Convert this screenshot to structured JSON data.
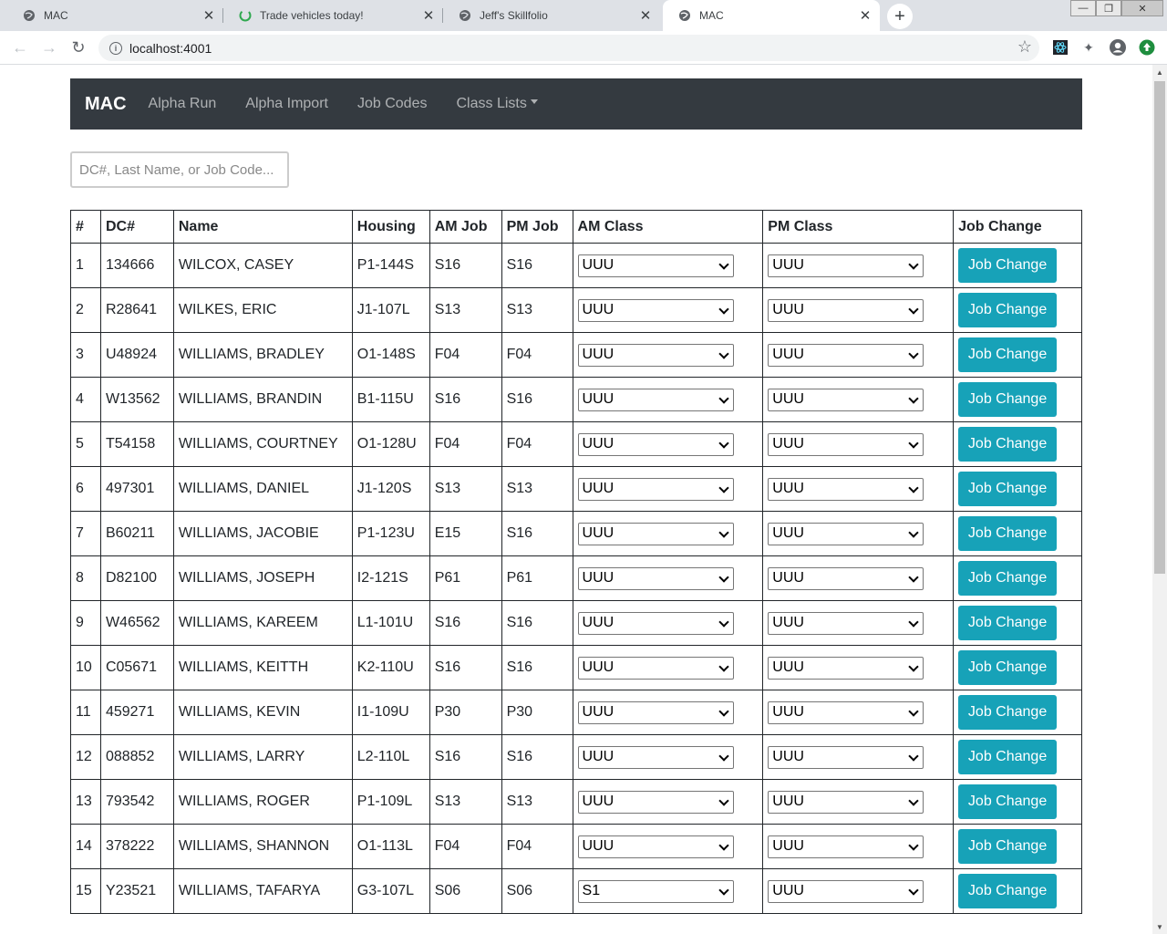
{
  "browser": {
    "tabs": [
      {
        "title": "MAC",
        "icon": "globe-icon"
      },
      {
        "title": "Trade vehicles today!",
        "icon": "loading-icon"
      },
      {
        "title": "Jeff's Skillfolio",
        "icon": "globe-icon"
      },
      {
        "title": "MAC",
        "icon": "globe-icon",
        "active": true
      }
    ],
    "url": "localhost:4001"
  },
  "navbar": {
    "brand": "MAC",
    "links": [
      "Alpha Run",
      "Alpha Import",
      "Job Codes",
      "Class Lists"
    ]
  },
  "search": {
    "placeholder": "DC#, Last Name, or Job Code...",
    "value": ""
  },
  "table": {
    "headers": [
      "#",
      "DC#",
      "Name",
      "Housing",
      "AM Job",
      "PM Job",
      "AM Class",
      "PM Class",
      "Job Change"
    ],
    "button_label": "Job Change",
    "rows": [
      {
        "num": "1",
        "dc": "134666",
        "name": "WILCOX, CASEY",
        "housing": "P1-144S",
        "am_job": "S16",
        "pm_job": "S16",
        "am_class": "UUU",
        "pm_class": "UUU"
      },
      {
        "num": "2",
        "dc": "R28641",
        "name": "WILKES, ERIC",
        "housing": "J1-107L",
        "am_job": "S13",
        "pm_job": "S13",
        "am_class": "UUU",
        "pm_class": "UUU"
      },
      {
        "num": "3",
        "dc": "U48924",
        "name": "WILLIAMS, BRADLEY",
        "housing": "O1-148S",
        "am_job": "F04",
        "pm_job": "F04",
        "am_class": "UUU",
        "pm_class": "UUU"
      },
      {
        "num": "4",
        "dc": "W13562",
        "name": "WILLIAMS, BRANDIN",
        "housing": "B1-115U",
        "am_job": "S16",
        "pm_job": "S16",
        "am_class": "UUU",
        "pm_class": "UUU"
      },
      {
        "num": "5",
        "dc": "T54158",
        "name": "WILLIAMS, COURTNEY",
        "housing": "O1-128U",
        "am_job": "F04",
        "pm_job": "F04",
        "am_class": "UUU",
        "pm_class": "UUU"
      },
      {
        "num": "6",
        "dc": "497301",
        "name": "WILLIAMS, DANIEL",
        "housing": "J1-120S",
        "am_job": "S13",
        "pm_job": "S13",
        "am_class": "UUU",
        "pm_class": "UUU"
      },
      {
        "num": "7",
        "dc": "B60211",
        "name": "WILLIAMS, JACOBIE",
        "housing": "P1-123U",
        "am_job": "E15",
        "pm_job": "S16",
        "am_class": "UUU",
        "pm_class": "UUU"
      },
      {
        "num": "8",
        "dc": "D82100",
        "name": "WILLIAMS, JOSEPH",
        "housing": "I2-121S",
        "am_job": "P61",
        "pm_job": "P61",
        "am_class": "UUU",
        "pm_class": "UUU"
      },
      {
        "num": "9",
        "dc": "W46562",
        "name": "WILLIAMS, KAREEM",
        "housing": "L1-101U",
        "am_job": "S16",
        "pm_job": "S16",
        "am_class": "UUU",
        "pm_class": "UUU"
      },
      {
        "num": "10",
        "dc": "C05671",
        "name": "WILLIAMS, KEITTH",
        "housing": "K2-110U",
        "am_job": "S16",
        "pm_job": "S16",
        "am_class": "UUU",
        "pm_class": "UUU"
      },
      {
        "num": "11",
        "dc": "459271",
        "name": "WILLIAMS, KEVIN",
        "housing": "I1-109U",
        "am_job": "P30",
        "pm_job": "P30",
        "am_class": "UUU",
        "pm_class": "UUU"
      },
      {
        "num": "12",
        "dc": "088852",
        "name": "WILLIAMS, LARRY",
        "housing": "L2-110L",
        "am_job": "S16",
        "pm_job": "S16",
        "am_class": "UUU",
        "pm_class": "UUU"
      },
      {
        "num": "13",
        "dc": "793542",
        "name": "WILLIAMS, ROGER",
        "housing": "P1-109L",
        "am_job": "S13",
        "pm_job": "S13",
        "am_class": "UUU",
        "pm_class": "UUU"
      },
      {
        "num": "14",
        "dc": "378222",
        "name": "WILLIAMS, SHANNON",
        "housing": "O1-113L",
        "am_job": "F04",
        "pm_job": "F04",
        "am_class": "UUU",
        "pm_class": "UUU"
      },
      {
        "num": "15",
        "dc": "Y23521",
        "name": "WILLIAMS, TAFARYA",
        "housing": "G3-107L",
        "am_job": "S06",
        "pm_job": "S06",
        "am_class": "S1",
        "pm_class": "UUU"
      }
    ]
  },
  "colors": {
    "navbar_bg": "#343a40",
    "button_bg": "#17a2b8"
  }
}
